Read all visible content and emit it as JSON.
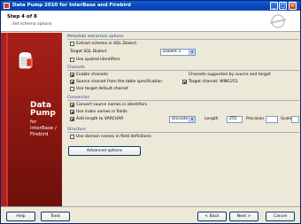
{
  "window": {
    "title": "Data Pump 2010 for InterBase and Firebird",
    "min_glyph": "_",
    "max_glyph": "□",
    "close_glyph": "×"
  },
  "header": {
    "step": "Step 4 of 8",
    "subtitle": "Set schema options"
  },
  "sidebar": {
    "brand_line1": "Data",
    "brand_line2": "Pump",
    "brand_sub": "for InterBase / Firebird"
  },
  "groups": {
    "metadata": "Metadata extraction options",
    "charsets": "Charsets",
    "conversion": "Conversion",
    "structure": "Structure"
  },
  "metadata": {
    "opt1": "Extract schema in SQL Dialect",
    "dialect_label": "Target SQL Dialect",
    "dialect_value": "Dialect 3",
    "opt2": "Use quoted identifiers"
  },
  "charsets": {
    "opt1": "Enable charsets",
    "opt2": "Source charset from the table specification",
    "note": "Charsets supported by source and target",
    "target_label": "Target charset: WIN1251",
    "opt3": "Use target default charset"
  },
  "conversion": {
    "opt1": "Convert source names in identifiers",
    "opt2": "Use index names in fields",
    "opt3": "Add length to VARCHAR",
    "type_value": "Unicode",
    "len_label": "Length",
    "len_value": "255",
    "prec_label": "Precision",
    "prec_value": "",
    "scale_label": "Scale",
    "scale_value": ""
  },
  "structure": {
    "opt1": "Use domain names in field definitions"
  },
  "buttons": {
    "advanced": "Advanced options",
    "help": "Help",
    "tools": "Tools",
    "back": "< Back",
    "next": "Next >",
    "cancel": "Cancel"
  },
  "colors": {
    "accent": "#1b3fa8",
    "sidebar": "#8e1a12",
    "titlebar": "#0a43b5"
  }
}
